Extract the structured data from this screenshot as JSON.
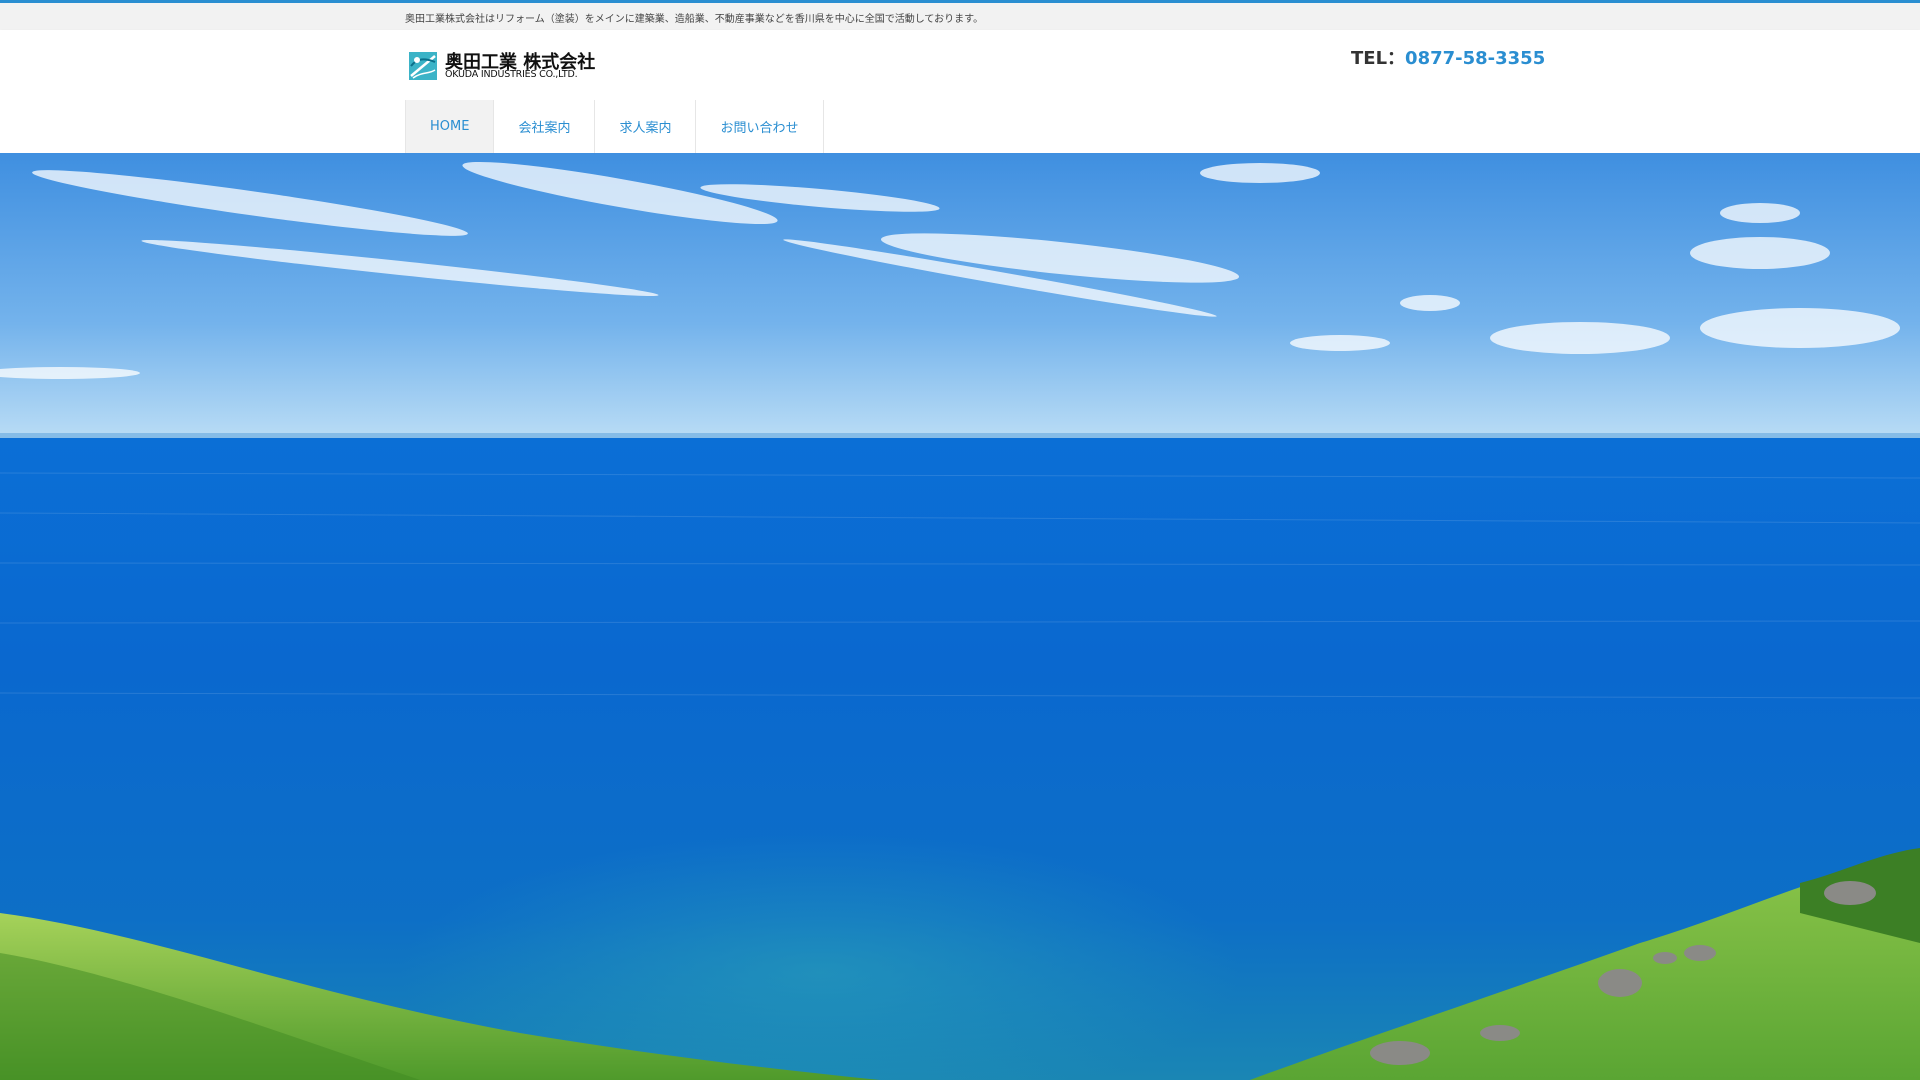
{
  "brand": {
    "tagline": "奥田工業株式会社はリフォーム（塗装）をメインに建築業、造船業、不動産事業などを香川県を中心に全国で活動しております。",
    "company_name_jp": "奥田工業 株式会社",
    "company_name_en": "OKUDA INDUSTRIES CO.,LTD."
  },
  "contact": {
    "tel_label": "TEL：",
    "tel_number": "0877-58-3355"
  },
  "nav": {
    "items": [
      {
        "label": "HOME",
        "active": true
      },
      {
        "label": "会社案内",
        "active": false
      },
      {
        "label": "求人案内",
        "active": false
      },
      {
        "label": "お問い合わせ",
        "active": false
      }
    ]
  },
  "hero": {
    "image": "ocean-coast-photo"
  },
  "colors": {
    "accent": "#2a8ed1",
    "top_border": "#2a8ed1",
    "info_bar": "#f2f2f2",
    "nav_active_bg": "#f2f2f2"
  }
}
